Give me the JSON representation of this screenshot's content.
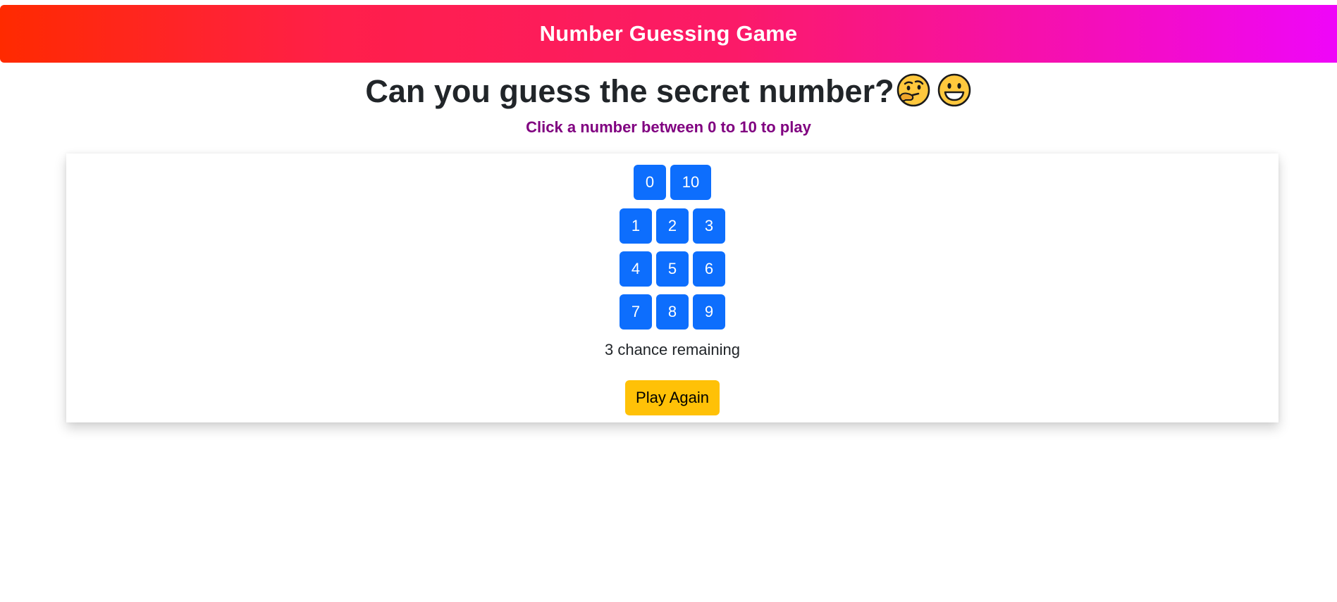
{
  "header": {
    "title": "Number Guessing Game"
  },
  "headline": {
    "text": "Can you guess the secret number?",
    "emojis": [
      "thinking-face-icon",
      "grinning-face-icon"
    ]
  },
  "instruction": "Click a number between 0 to 10 to play",
  "keypad": {
    "top_row": [
      "0",
      "10"
    ],
    "rows": [
      [
        "1",
        "2",
        "3"
      ],
      [
        "4",
        "5",
        "6"
      ],
      [
        "7",
        "8",
        "9"
      ]
    ]
  },
  "status": {
    "remaining_text": "3 chance remaining"
  },
  "actions": {
    "play_again_label": "Play Again"
  },
  "colors": {
    "header_gradient_start": "#ff2a00",
    "header_gradient_end": "#ef06f9",
    "number_button": "#0d6efd",
    "play_again_button": "#ffc107",
    "instruction_text": "#800080"
  }
}
